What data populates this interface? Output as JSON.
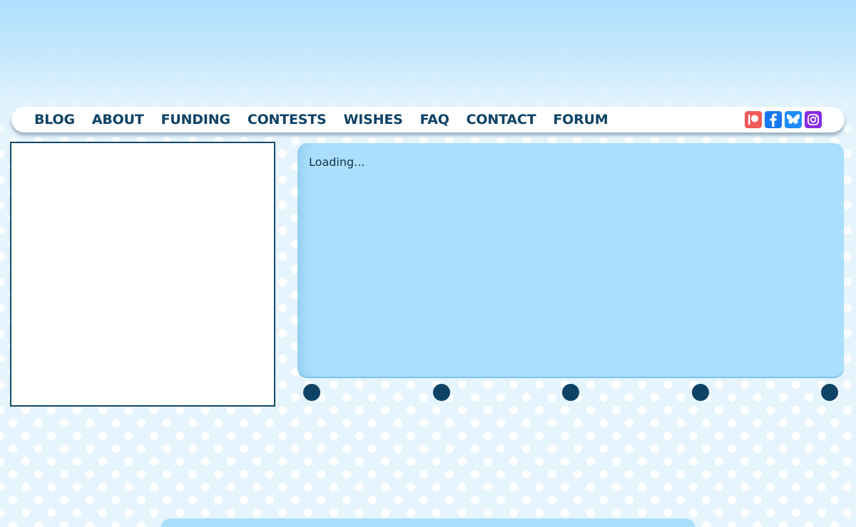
{
  "nav": {
    "items": [
      {
        "label": "BLOG"
      },
      {
        "label": "ABOUT"
      },
      {
        "label": "FUNDING"
      },
      {
        "label": "CONTESTS"
      },
      {
        "label": "WISHES"
      },
      {
        "label": "FAQ"
      },
      {
        "label": "CONTACT"
      },
      {
        "label": "FORUM"
      }
    ]
  },
  "social": [
    {
      "icon": "patreon-icon",
      "color": "#f05a5a"
    },
    {
      "icon": "facebook-icon",
      "color": "#1877f2"
    },
    {
      "icon": "bluesky-icon",
      "color": "#1d8cf8"
    },
    {
      "icon": "instagram-icon",
      "color": "#8a2be2"
    }
  ],
  "content": {
    "loading_text": "Loading..."
  },
  "pagination": {
    "dot_count": 5,
    "color": "#0f4366"
  },
  "colors": {
    "nav_text": "#0e4266",
    "panel_bg": "#abdffc",
    "page_bg": "#e6f4fd"
  }
}
